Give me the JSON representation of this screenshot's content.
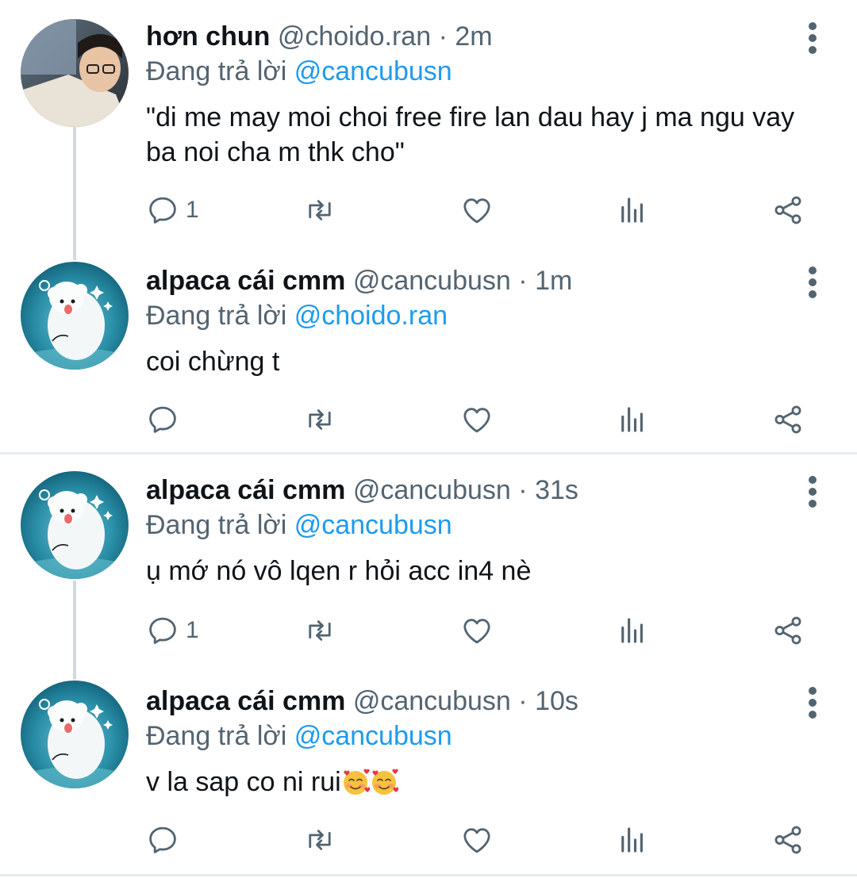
{
  "reply_prefix": "Đang trả lời",
  "tweets": [
    {
      "name": "hơn chun",
      "handle": "@choido.ran",
      "separator": "·",
      "time": "2m",
      "reply_to": "@cancubusn",
      "text": "\"di me may moi choi free fire lan dau hay j ma ngu vay ba noi cha m thk cho\"",
      "reply_count": "1"
    },
    {
      "name": "alpaca cái cmm",
      "handle": "@cancubusn",
      "separator": "·",
      "time": "1m",
      "reply_to": "@choido.ran",
      "text": "coi chừng t",
      "reply_count": ""
    },
    {
      "name": "alpaca cái cmm",
      "handle": "@cancubusn",
      "separator": "·",
      "time": "31s",
      "reply_to": "@cancubusn",
      "text": "ụ mớ nó vô lqen r hỏi acc in4 nè",
      "reply_count": "1"
    },
    {
      "name": "alpaca cái cmm",
      "handle": "@cancubusn",
      "separator": "·",
      "time": "10s",
      "reply_to": "@cancubusn",
      "text": "v la sap co ni rui",
      "reply_count": ""
    }
  ],
  "icons": {
    "reply": "reply-icon",
    "retweet": "retweet-icon",
    "like": "heart-icon",
    "views": "analytics-icon",
    "share": "share-icon",
    "more": "more-vertical-icon",
    "emoji": "smiling-face-with-hearts-emoji"
  },
  "colors": {
    "text": "#0f1419",
    "secondary": "#536471",
    "link": "#1d9bf0",
    "thread_line": "#cfd9de",
    "divider": "#e6ecf0"
  }
}
